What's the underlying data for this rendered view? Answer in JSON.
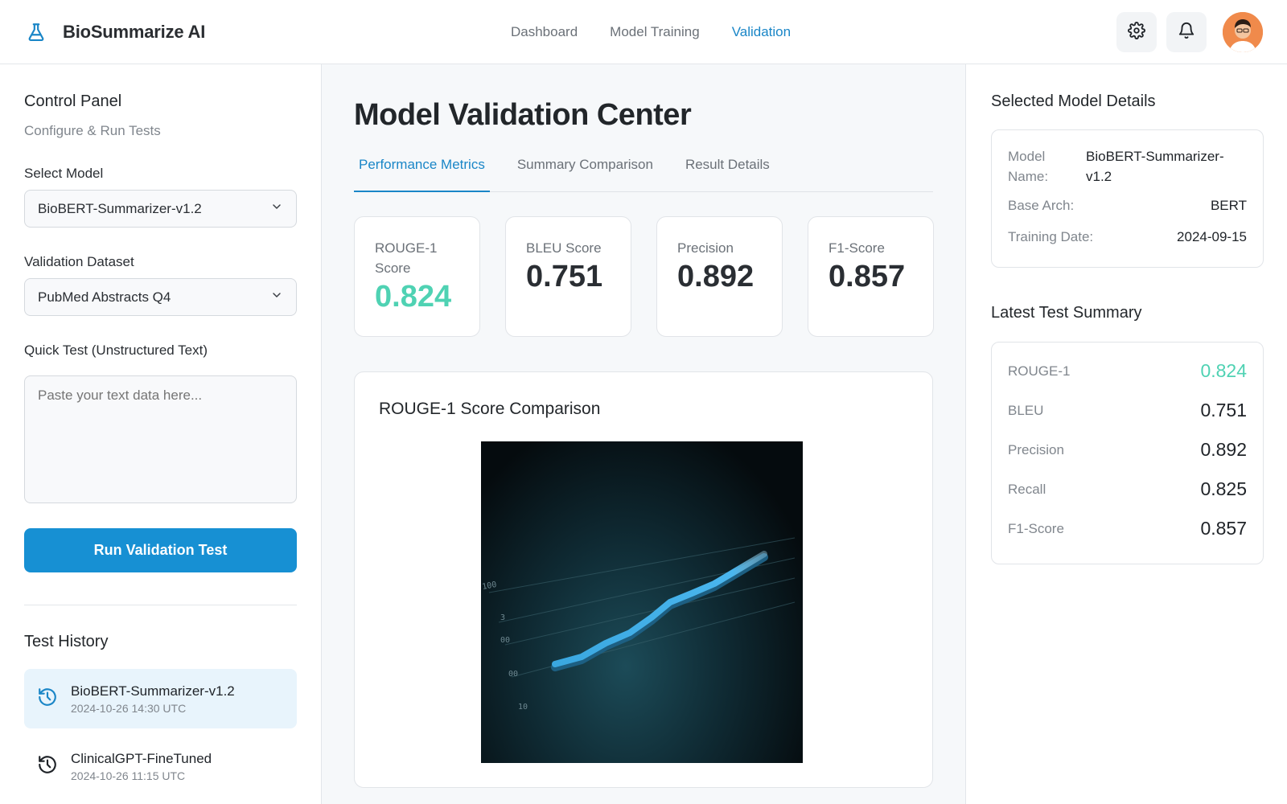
{
  "app": {
    "name": "BioSummarize AI",
    "logo_icon": "flask-icon"
  },
  "nav": {
    "items": [
      {
        "label": "Dashboard",
        "active": false
      },
      {
        "label": "Model Training",
        "active": false
      },
      {
        "label": "Validation",
        "active": true
      }
    ]
  },
  "header_actions": {
    "settings_icon": "gear-icon",
    "notifications_icon": "bell-icon"
  },
  "control_panel": {
    "title": "Control Panel",
    "subtitle": "Configure & Run Tests",
    "model_label": "Select Model",
    "model_value": "BioBERT-Summarizer-v1.2",
    "dataset_label": "Validation Dataset",
    "dataset_value": "PubMed Abstracts Q4",
    "quick_test_label": "Quick Test (Unstructured Text)",
    "quick_test_placeholder": "Paste your text data here...",
    "run_button": "Run Validation Test"
  },
  "history": {
    "title": "Test History",
    "items": [
      {
        "name": "BioBERT-Summarizer-v1.2",
        "time": "2024-10-26 14:30 UTC",
        "active": true
      },
      {
        "name": "ClinicalGPT-FineTuned",
        "time": "2024-10-26 11:15 UTC",
        "active": false
      }
    ]
  },
  "main": {
    "title": "Model Validation Center",
    "tabs": [
      {
        "label": "Performance Metrics",
        "active": true
      },
      {
        "label": "Summary Comparison",
        "active": false
      },
      {
        "label": "Result Details",
        "active": false
      }
    ],
    "metrics": [
      {
        "label": "ROUGE-1 Score",
        "value": "0.824",
        "accent": true
      },
      {
        "label": "BLEU Score",
        "value": "0.751",
        "accent": false
      },
      {
        "label": "Precision",
        "value": "0.892",
        "accent": false
      },
      {
        "label": "F1-Score",
        "value": "0.857",
        "accent": false
      }
    ],
    "chart_title": "ROUGE-1 Score Comparison"
  },
  "selected_model": {
    "title": "Selected Model Details",
    "rows": [
      {
        "key": "Model Name:",
        "value": "BioBERT-Summarizer-v1.2"
      },
      {
        "key": "Base Arch:",
        "value": "BERT"
      },
      {
        "key": "Training Date:",
        "value": "2024-09-15"
      }
    ]
  },
  "latest_summary": {
    "title": "Latest Test Summary",
    "rows": [
      {
        "key": "ROUGE-1",
        "value": "0.824",
        "accent": true
      },
      {
        "key": "BLEU",
        "value": "0.751",
        "accent": false
      },
      {
        "key": "Precision",
        "value": "0.892",
        "accent": false
      },
      {
        "key": "Recall",
        "value": "0.825",
        "accent": false
      },
      {
        "key": "F1-Score",
        "value": "0.857",
        "accent": false
      }
    ]
  },
  "chart_image_labels": [
    "100",
    "3",
    "00",
    "00",
    "10"
  ],
  "colors": {
    "accent_blue": "#1a86c7",
    "accent_teal": "#4fd2b3",
    "button_blue": "#1790d3"
  }
}
